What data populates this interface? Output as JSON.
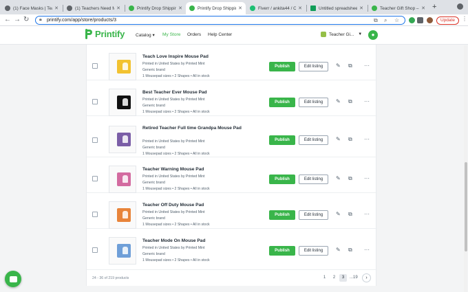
{
  "browser": {
    "tabs": [
      {
        "title": "(1) Face Masks | Teac",
        "favicon": "globe-icon",
        "active": false
      },
      {
        "title": "(1) Teachers Need M",
        "favicon": "globe-icon",
        "active": false
      },
      {
        "title": "Printify Drop Shippin",
        "favicon": "printify-icon",
        "active": false
      },
      {
        "title": "Printify Drop Shippin",
        "favicon": "printify-icon",
        "active": true
      },
      {
        "title": "Fiverr / ankita44 / Or",
        "favicon": "fiverr-icon",
        "active": false
      },
      {
        "title": "Untitled spreadsheet",
        "favicon": "sheets-icon",
        "active": false
      },
      {
        "title": "Teacher Gift Shop – F",
        "favicon": "printify-icon",
        "active": false
      }
    ],
    "new_tab": "+",
    "url": "printify.com/app/store/products/3",
    "update_label": "Update"
  },
  "header": {
    "logo_text": "Printify",
    "nav": [
      "Catalog ▾",
      "My Store",
      "Orders",
      "Help Center"
    ],
    "active_nav": "My Store",
    "store_name": "Teacher Gi..."
  },
  "products": [
    {
      "title": "Teach Love Inspire Mouse Pad",
      "printed_by": "Printed in United States by Printed Mint",
      "brand": "Generic brand",
      "variants": "1 Mousepad sizes • 2 Shapes • All in stock",
      "thumb_color": "#f2c230"
    },
    {
      "title": "Best Teacher Ever Mouse Pad",
      "printed_by": "Printed in United States by Printed Mint",
      "brand": "Generic brand",
      "variants": "1 Mousepad sizes • 2 Shapes • All in stock",
      "thumb_color": "#111111"
    },
    {
      "title": "Retired Teacher Full time Grandpa Mouse Pad",
      "printed_by": "Printed in United States by Printed Mint",
      "brand": "Generic brand",
      "variants": "1 Mousepad sizes • 2 Shapes • All in stock",
      "thumb_color": "#7b5ea7"
    },
    {
      "title": "Teacher Warning Mouse Pad",
      "printed_by": "Printed in United States by Printed Mint",
      "brand": "Generic brand",
      "variants": "1 Mousepad sizes • 2 Shapes • All in stock",
      "thumb_color": "#d36ba0"
    },
    {
      "title": "Teacher Off Duty Mouse Pad",
      "printed_by": "Printed in United States by Printed Mint",
      "brand": "Generic brand",
      "variants": "1 Mousepad sizes • 2 Shapes • All in stock",
      "thumb_color": "#e8843a"
    },
    {
      "title": "Teacher Mode On Mouse Pad",
      "printed_by": "Printed in United States by Printed Mint",
      "brand": "Generic brand",
      "variants": "1 Mousepad sizes • 2 Shapes • All in stock",
      "thumb_color": "#6f9fd8"
    }
  ],
  "actions": {
    "publish_label": "Publish",
    "edit_label": "Edit listing"
  },
  "pagination": {
    "summary": "24 - 36 of 219 products",
    "pages": [
      "1",
      "2",
      "3",
      "...19"
    ],
    "current": "3",
    "next": "›"
  },
  "colors": {
    "brand": "#39b54a",
    "update": "#d93025"
  }
}
